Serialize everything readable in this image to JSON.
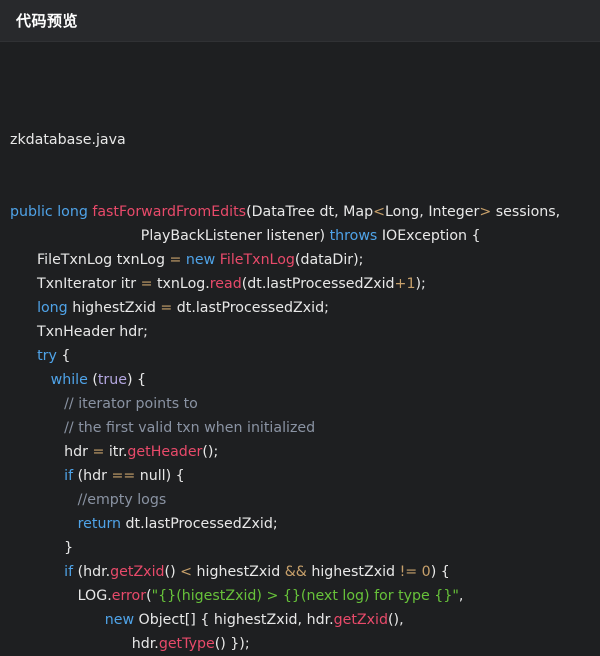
{
  "header": {
    "title": "代码预览"
  },
  "code": {
    "filename": "zkdatabase.java",
    "lines": [
      [
        [
          "kw",
          "public"
        ],
        [
          "plain",
          " "
        ],
        [
          "kw",
          "long"
        ],
        [
          "plain",
          " "
        ],
        [
          "fn",
          "fastForwardFromEdits"
        ],
        [
          "plain",
          "(DataTree dt, Map"
        ],
        [
          "op",
          "<"
        ],
        [
          "plain",
          "Long, Integer"
        ],
        [
          "op",
          ">"
        ],
        [
          "plain",
          " sessions,"
        ]
      ],
      [
        [
          "plain",
          "                             PlayBackListener listener) "
        ],
        [
          "kw",
          "throws"
        ],
        [
          "plain",
          " IOException {"
        ]
      ],
      [
        [
          "plain",
          "      FileTxnLog txnLog "
        ],
        [
          "op",
          "="
        ],
        [
          "plain",
          " "
        ],
        [
          "kw",
          "new"
        ],
        [
          "plain",
          " "
        ],
        [
          "fn",
          "FileTxnLog"
        ],
        [
          "plain",
          "(dataDir);"
        ]
      ],
      [
        [
          "plain",
          "      TxnIterator itr "
        ],
        [
          "op",
          "="
        ],
        [
          "plain",
          " txnLog."
        ],
        [
          "fn",
          "read"
        ],
        [
          "plain",
          "(dt.lastProcessedZxid"
        ],
        [
          "op",
          "+"
        ],
        [
          "num",
          "1"
        ],
        [
          "plain",
          ");"
        ]
      ],
      [
        [
          "plain",
          "      "
        ],
        [
          "kw",
          "long"
        ],
        [
          "plain",
          " highestZxid "
        ],
        [
          "op",
          "="
        ],
        [
          "plain",
          " dt.lastProcessedZxid;"
        ]
      ],
      [
        [
          "plain",
          "      TxnHeader hdr;"
        ]
      ],
      [
        [
          "plain",
          "      "
        ],
        [
          "kw",
          "try"
        ],
        [
          "plain",
          " {"
        ]
      ],
      [
        [
          "plain",
          "         "
        ],
        [
          "kw",
          "while"
        ],
        [
          "plain",
          " ("
        ],
        [
          "lit",
          "true"
        ],
        [
          "plain",
          ") {"
        ]
      ],
      [
        [
          "plain",
          "            "
        ],
        [
          "cm",
          "// iterator points to"
        ]
      ],
      [
        [
          "plain",
          "            "
        ],
        [
          "cm",
          "// the first valid txn when initialized"
        ]
      ],
      [
        [
          "plain",
          "            hdr "
        ],
        [
          "op",
          "="
        ],
        [
          "plain",
          " itr."
        ],
        [
          "fn",
          "getHeader"
        ],
        [
          "plain",
          "();"
        ]
      ],
      [
        [
          "plain",
          "            "
        ],
        [
          "kw",
          "if"
        ],
        [
          "plain",
          " (hdr "
        ],
        [
          "op",
          "=="
        ],
        [
          "plain",
          " null) {"
        ]
      ],
      [
        [
          "plain",
          "               "
        ],
        [
          "cm",
          "//empty logs"
        ]
      ],
      [
        [
          "plain",
          "               "
        ],
        [
          "kw",
          "return"
        ],
        [
          "plain",
          " dt.lastProcessedZxid;"
        ]
      ],
      [
        [
          "plain",
          "            }"
        ]
      ],
      [
        [
          "plain",
          "            "
        ],
        [
          "kw",
          "if"
        ],
        [
          "plain",
          " (hdr."
        ],
        [
          "fn",
          "getZxid"
        ],
        [
          "plain",
          "() "
        ],
        [
          "op",
          "<"
        ],
        [
          "plain",
          " highestZxid "
        ],
        [
          "op",
          "&&"
        ],
        [
          "plain",
          " highestZxid "
        ],
        [
          "op",
          "!="
        ],
        [
          "plain",
          " "
        ],
        [
          "num",
          "0"
        ],
        [
          "plain",
          ") {"
        ]
      ],
      [
        [
          "plain",
          "               LOG."
        ],
        [
          "fn",
          "error"
        ],
        [
          "plain",
          "("
        ],
        [
          "str",
          "\"{}(higestZxid) > {}(next log) for type {}\""
        ],
        [
          "plain",
          ","
        ]
      ],
      [
        [
          "plain",
          "                     "
        ],
        [
          "kw",
          "new"
        ],
        [
          "plain",
          " Object[] { highestZxid, hdr."
        ],
        [
          "fn",
          "getZxid"
        ],
        [
          "plain",
          "(),"
        ]
      ],
      [
        [
          "plain",
          "                           hdr."
        ],
        [
          "fn",
          "getType"
        ],
        [
          "plain",
          "() });"
        ]
      ]
    ]
  }
}
